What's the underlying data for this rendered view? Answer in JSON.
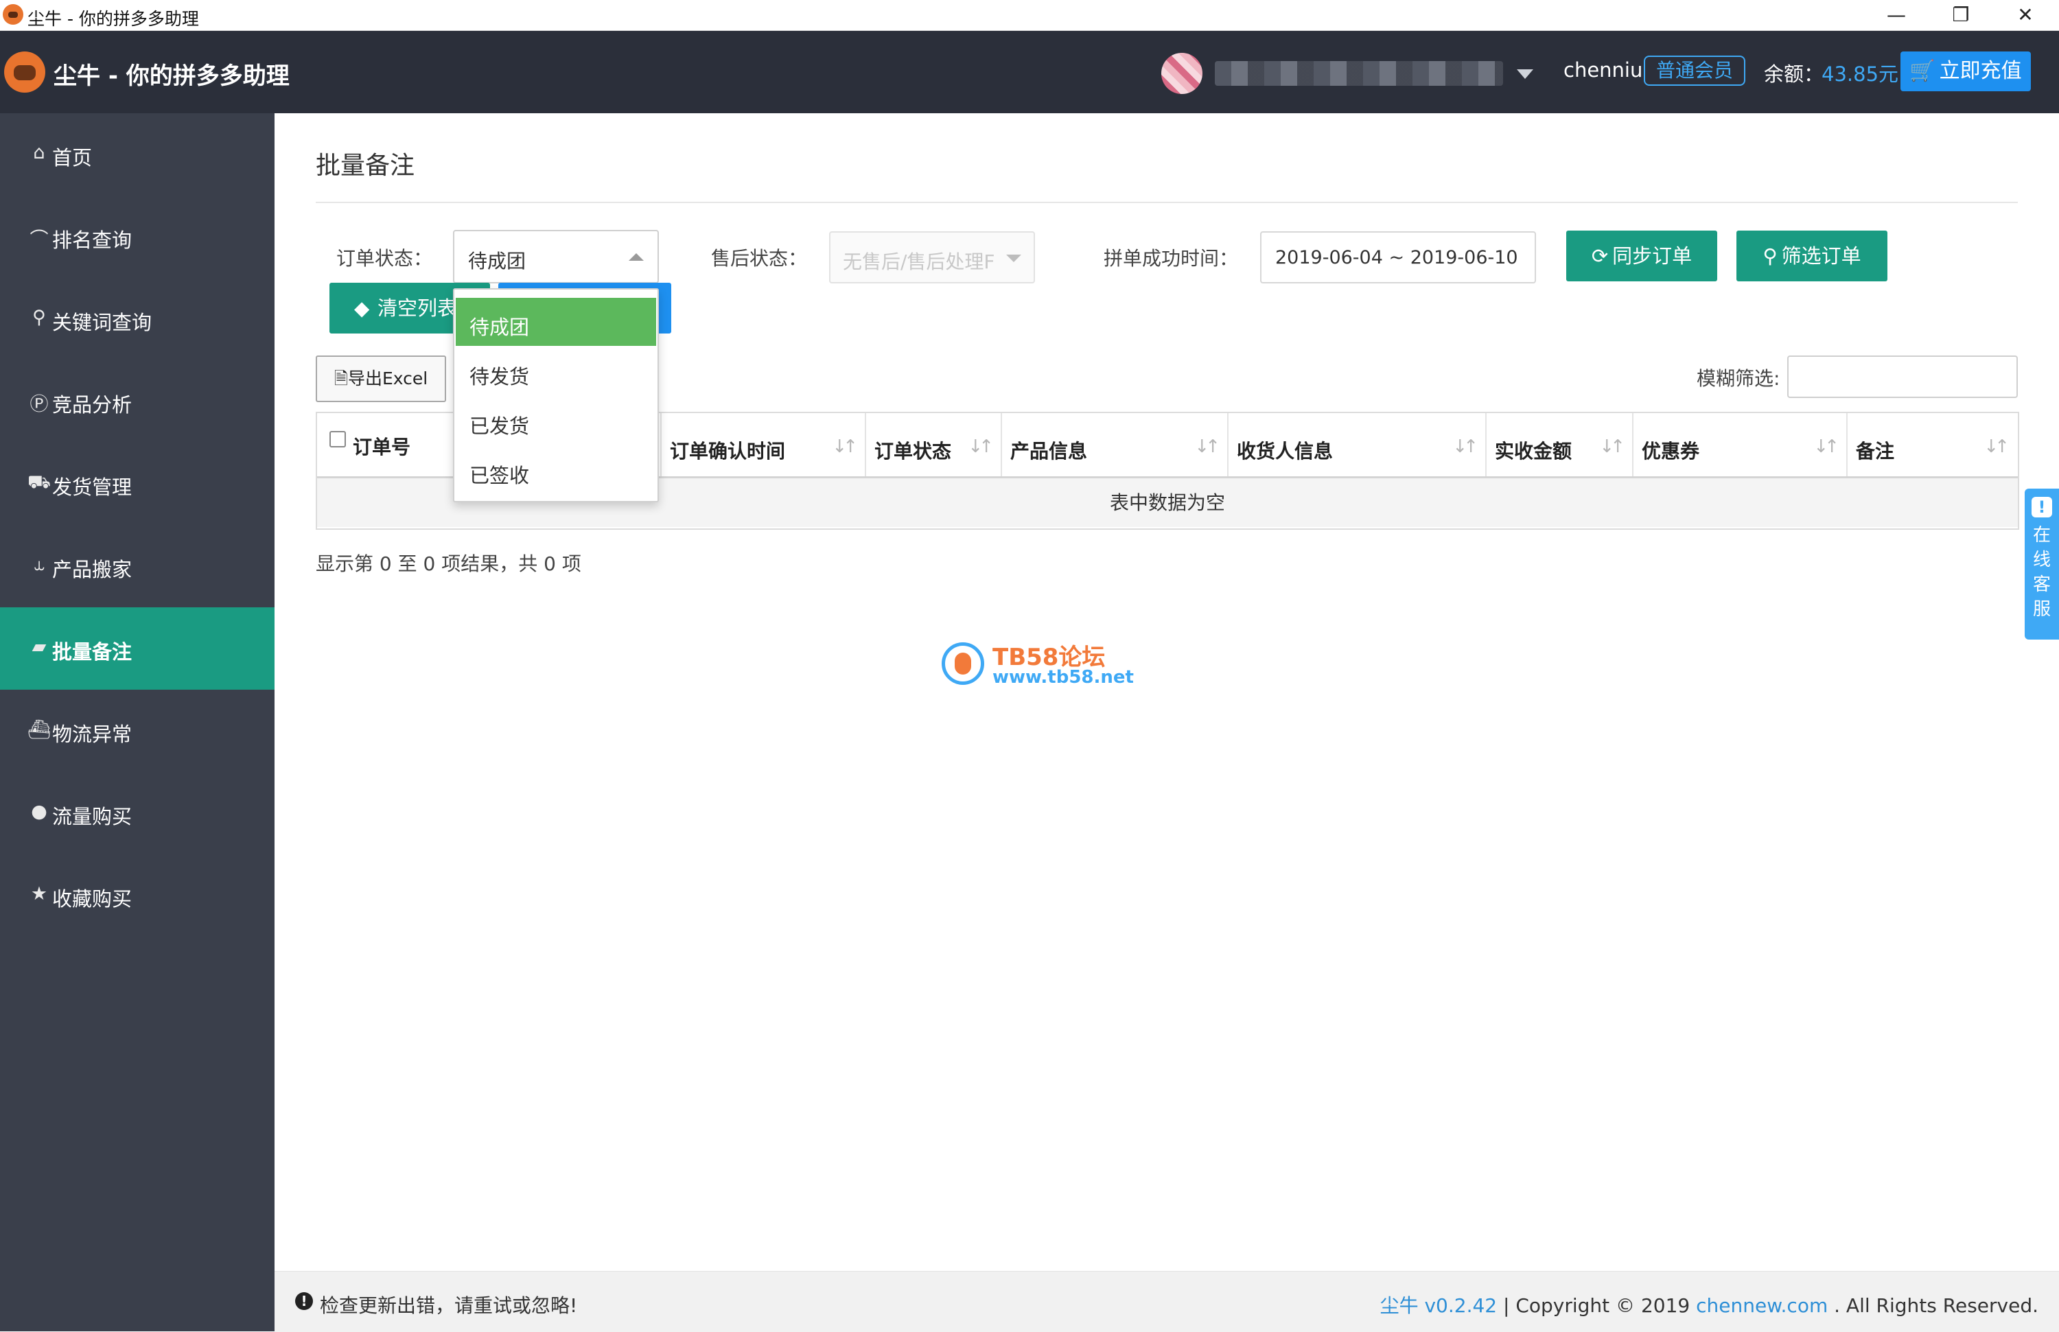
{
  "window": {
    "title": "尘牛 - 你的拼多多助理",
    "controls": {
      "minimize": "—",
      "restore": "❐",
      "close": "✕"
    }
  },
  "header": {
    "app_title": "尘牛 - 你的拼多多助理",
    "username": "chenniu",
    "member_badge": "普通会员",
    "balance_label": "余额：",
    "balance_value": "43.85元",
    "recharge_label": "立即充值"
  },
  "sidebar": {
    "items": [
      {
        "label": "首页",
        "icon": "home-icon",
        "glyph": "⌂"
      },
      {
        "label": "排名查询",
        "icon": "line-chart-icon",
        "glyph": "⌒"
      },
      {
        "label": "关键词查询",
        "icon": "search-icon",
        "glyph": "⚲"
      },
      {
        "label": "竞品分析",
        "icon": "product-hunt-icon",
        "glyph": "Ⓟ"
      },
      {
        "label": "发货管理",
        "icon": "truck-icon",
        "glyph": "⛟"
      },
      {
        "label": "产品搬家",
        "icon": "dolly-icon",
        "glyph": "⥿"
      },
      {
        "label": "批量备注",
        "icon": "sticky-note-icon",
        "glyph": "▰",
        "active": true
      },
      {
        "label": "物流异常",
        "icon": "ship-icon",
        "glyph": "⛴"
      },
      {
        "label": "流量购买",
        "icon": "lightbulb-icon",
        "glyph": "●"
      },
      {
        "label": "收藏购买",
        "icon": "star-icon",
        "glyph": "★"
      }
    ]
  },
  "main": {
    "page_title": "批量备注",
    "filters": {
      "order_status_label": "订单状态：",
      "order_status_value": "待成团",
      "aftersale_label": "售后状态：",
      "aftersale_placeholder": "无售后/售后处理F",
      "date_label": "拼单成功时间：",
      "date_range": "2019-06-04 ~ 2019-06-10",
      "sync_button": "同步订单",
      "filter_button": "筛选订单",
      "clear_button": "清空列表"
    },
    "export_button": "导出Excel",
    "fuzzy_label": "模糊筛选:",
    "table": {
      "columns": [
        "订单号",
        "订单确认时间",
        "订单状态",
        "产品信息",
        "收货人信息",
        "实收金额",
        "优惠券",
        "备注"
      ],
      "empty_text": "表中数据为空"
    },
    "result_info": "显示第 0 至 0 项结果，共 0 项",
    "dropdown": {
      "options": [
        "待成团",
        "待发货",
        "已发货",
        "已签收"
      ],
      "selected": "待成团"
    }
  },
  "watermark": {
    "title": "TB58论坛",
    "url": "www.tb58.net"
  },
  "support_tab": {
    "label": "在线客服"
  },
  "footer": {
    "warning": "检查更新出错，请重试或忽略!",
    "version_link": "尘牛 v0.2.42",
    "copyright_mid": " | Copyright © 2019 ",
    "site_link": "chennew.com",
    "copyright_tail": " . All Rights Reserved."
  },
  "colors": {
    "accent": "#1a9b82",
    "header_bg": "#2b2f3a",
    "sidebar_bg": "#3a3f4b",
    "link": "#3fa9f5",
    "dropdown_selected": "#5cb85c"
  }
}
